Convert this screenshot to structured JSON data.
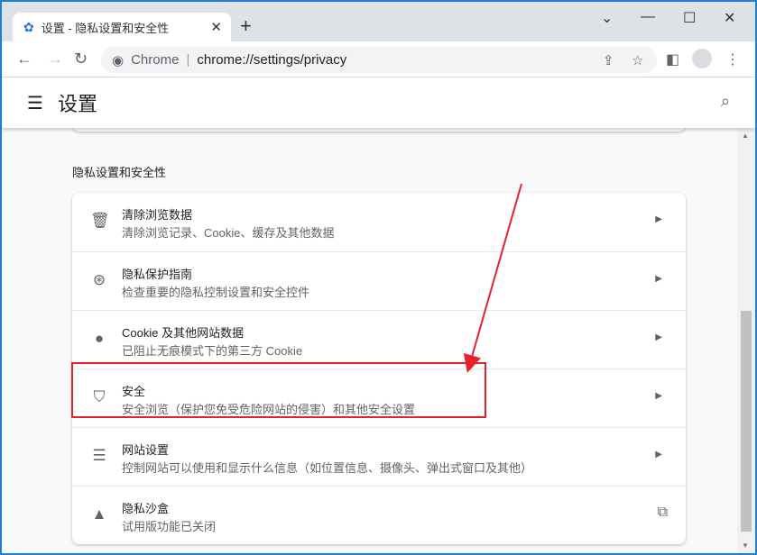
{
  "tab": {
    "title": "设置 - 隐私设置和安全性",
    "icon": "gear-icon"
  },
  "address": {
    "site": "Chrome",
    "url": "chrome://settings/privacy"
  },
  "header": {
    "title": "设置"
  },
  "section": {
    "title": "隐私设置和安全性"
  },
  "items": [
    {
      "icon": "trash-icon",
      "title": "清除浏览数据",
      "subtitle": "清除浏览记录、Cookie、缓存及其他数据"
    },
    {
      "icon": "privacy-guide-icon",
      "title": "隐私保护指南",
      "subtitle": "检查重要的隐私控制设置和安全控件"
    },
    {
      "icon": "cookie-icon",
      "title": "Cookie 及其他网站数据",
      "subtitle": "已阻止无痕模式下的第三方 Cookie"
    },
    {
      "icon": "shield-icon",
      "title": "安全",
      "subtitle": "安全浏览（保护您免受危险网站的侵害）和其他安全设置"
    },
    {
      "icon": "tune-icon",
      "title": "网站设置",
      "subtitle": "控制网站可以使用和显示什么信息（如位置信息、摄像头、弹出式窗口及其他）"
    },
    {
      "icon": "flask-icon",
      "title": "隐私沙盒",
      "subtitle": "试用版功能已关闭"
    }
  ],
  "annotation_color": "#e8202a"
}
